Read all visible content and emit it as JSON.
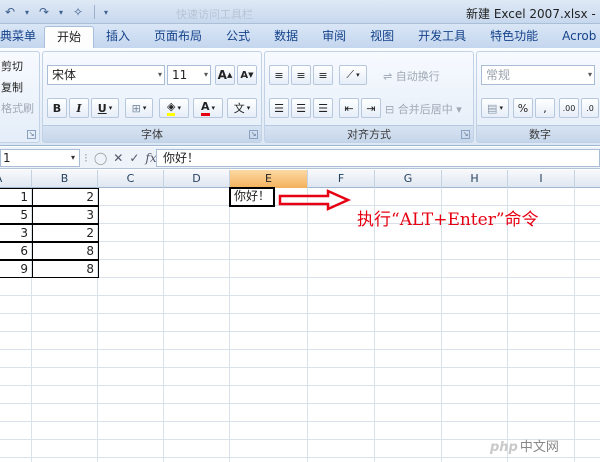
{
  "window": {
    "title": "新建 Excel 2007.xlsx - Mic",
    "ghost_text": "快速访问工具栏"
  },
  "tabs": [
    {
      "label": "典菜单"
    },
    {
      "label": "开始"
    },
    {
      "label": "插入"
    },
    {
      "label": "页面布局"
    },
    {
      "label": "公式"
    },
    {
      "label": "数据"
    },
    {
      "label": "审阅"
    },
    {
      "label": "视图"
    },
    {
      "label": "开发工具"
    },
    {
      "label": "特色功能"
    },
    {
      "label": "Acrob"
    }
  ],
  "ribbon": {
    "clipboard": {
      "cut": "剪切",
      "copy": "复制",
      "format_painter": "格式刷"
    },
    "font": {
      "label": "字体",
      "font_name": "宋体",
      "font_size": "11",
      "grow": "A",
      "shrink": "A",
      "bold": "B",
      "italic": "I",
      "underline": "U",
      "font_color": "A",
      "phonetic": "文"
    },
    "alignment": {
      "label": "对齐方式",
      "wrap_text": "自动换行",
      "merge_center": "合并后居中"
    },
    "number": {
      "label": "数字",
      "format": "常规",
      "percent": "%"
    }
  },
  "formula_bar": {
    "name_box": "1",
    "content": "你好！"
  },
  "columns": [
    {
      "label": "A"
    },
    {
      "label": "B"
    },
    {
      "label": "C"
    },
    {
      "label": "D"
    },
    {
      "label": "E"
    },
    {
      "label": "F"
    },
    {
      "label": "G"
    },
    {
      "label": "H"
    },
    {
      "label": "I"
    }
  ],
  "cells": {
    "a": [
      "1",
      "5",
      "3",
      "6",
      "9"
    ],
    "b": [
      "2",
      "3",
      "2",
      "8",
      "8"
    ],
    "e1": "你好！"
  },
  "annotation": "执行“ALT+Enter”命令",
  "watermark": {
    "logo": "php",
    "site": "中文网"
  },
  "colors": {
    "annotation": "#e60012",
    "selected_header": "#f4b15c",
    "tab_text": "#15428b"
  }
}
